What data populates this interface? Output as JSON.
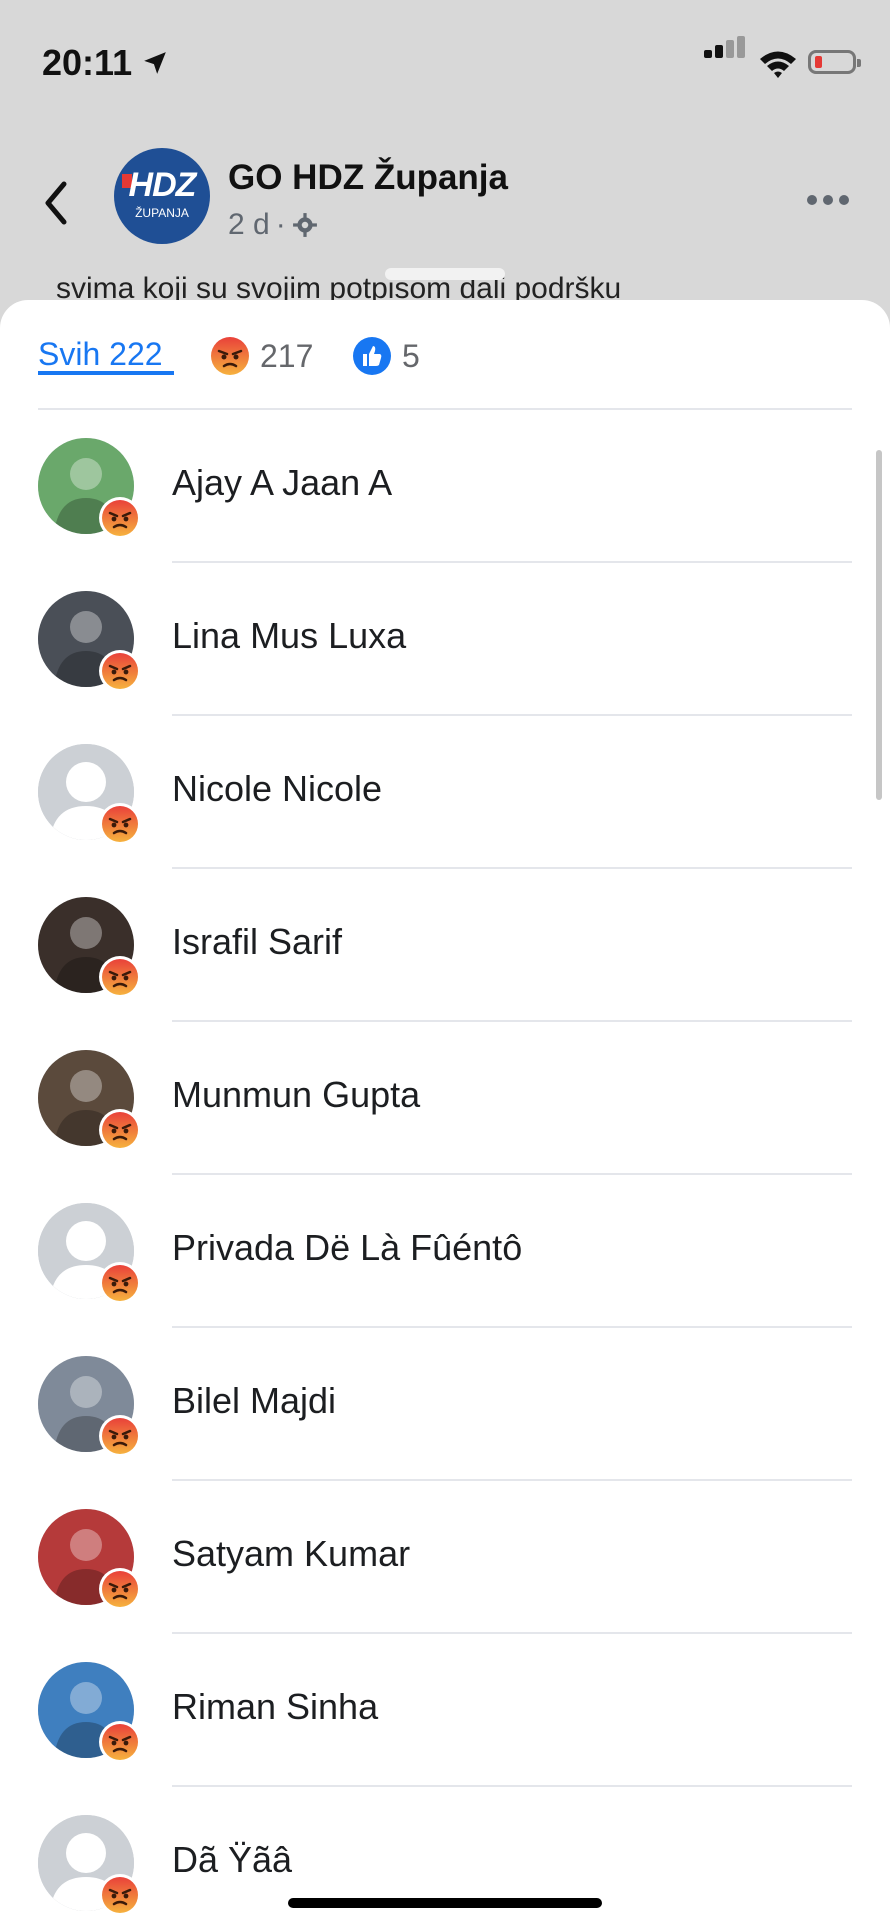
{
  "status_bar": {
    "time": "20:11"
  },
  "header": {
    "page_name": "GO HDZ Županja",
    "page_logo_text": "HDZ",
    "page_logo_sub": "ŽUPANJA",
    "post_age": "2 d",
    "separator": "·",
    "post_snippet": "svima koji su svojim potpisom dali podršku"
  },
  "tabs": [
    {
      "label": "Svih 222",
      "icon": null,
      "active": true
    },
    {
      "label": "217",
      "icon": "angry-reaction-icon",
      "active": false
    },
    {
      "label": "5",
      "icon": "like-reaction-icon",
      "active": false
    }
  ],
  "people": [
    {
      "name": "Ajay A Jaan A",
      "avatar_color": "#6aa86b",
      "reaction": "angry"
    },
    {
      "name": "Lina Mus Luxa",
      "avatar_color": "#4a4f57",
      "reaction": "angry"
    },
    {
      "name": "Nicole Nicole",
      "avatar_color": "default",
      "reaction": "angry"
    },
    {
      "name": "Israfil Sarif",
      "avatar_color": "#3a2f2a",
      "reaction": "angry"
    },
    {
      "name": "Munmun Gupta",
      "avatar_color": "#5b4a3c",
      "reaction": "angry"
    },
    {
      "name": "Privada Dë Là Fûéntô",
      "avatar_color": "default",
      "reaction": "angry"
    },
    {
      "name": "Bilel Majdi",
      "avatar_color": "#7f8a99",
      "reaction": "angry"
    },
    {
      "name": "Satyam Kumar",
      "avatar_color": "#b53a3a",
      "reaction": "angry"
    },
    {
      "name": "Riman Sinha",
      "avatar_color": "#3f7fbf",
      "reaction": "angry"
    },
    {
      "name": "Dã Ÿãâ",
      "avatar_color": "default",
      "reaction": "angry"
    }
  ],
  "colors": {
    "accent": "#1877f2",
    "angry": "#f0792e",
    "like": "#1877f2"
  }
}
